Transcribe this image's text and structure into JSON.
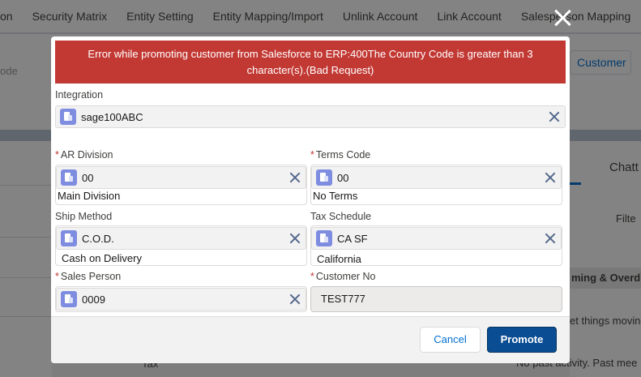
{
  "background": {
    "tabs": [
      "on",
      "Security Matrix",
      "Entity Setting",
      "Entity Mapping/Import",
      "Unlink Account",
      "Link Account",
      "Salesperson Mapping"
    ],
    "left_label": "ode",
    "customer_tab": "Customer",
    "chatter_tab": "Chatt",
    "filter_label": "Filte",
    "upcoming_header": "ming & Overdu",
    "get_things": "et things movin",
    "past_activity": "No past activity. Past mee",
    "tax_label": "Tax"
  },
  "modal": {
    "error_message": "Error while promoting customer from Salesforce to ERP:400The Country Code is greater than 3 character(s).(Bad Request)",
    "integration": {
      "label": "Integration",
      "value": "sage100ABC"
    },
    "ar_division": {
      "label": "AR Division",
      "required_mark": "*",
      "value": "00",
      "description": "Main Division"
    },
    "terms_code": {
      "label": "Terms Code",
      "required_mark": "*",
      "value": "00",
      "description": "No Terms"
    },
    "ship_method": {
      "label": "Ship Method",
      "value": "C.O.D.",
      "description": "Cash on Delivery"
    },
    "tax_schedule": {
      "label": "Tax Schedule",
      "value": "CA SF",
      "description": "California"
    },
    "sales_person": {
      "label": "Sales Person",
      "required_mark": "*",
      "value": "0009"
    },
    "customer_no": {
      "label": "Customer No",
      "required_mark": "*",
      "value": "TEST777"
    },
    "cancel_label": "Cancel",
    "promote_label": "Promote"
  },
  "icons": {
    "close": "close-icon",
    "pill": "account-icon",
    "clear": "clear-icon"
  },
  "colors": {
    "error_bg": "#c23934",
    "brand_button": "#0b4d93",
    "link": "#0070d2"
  }
}
